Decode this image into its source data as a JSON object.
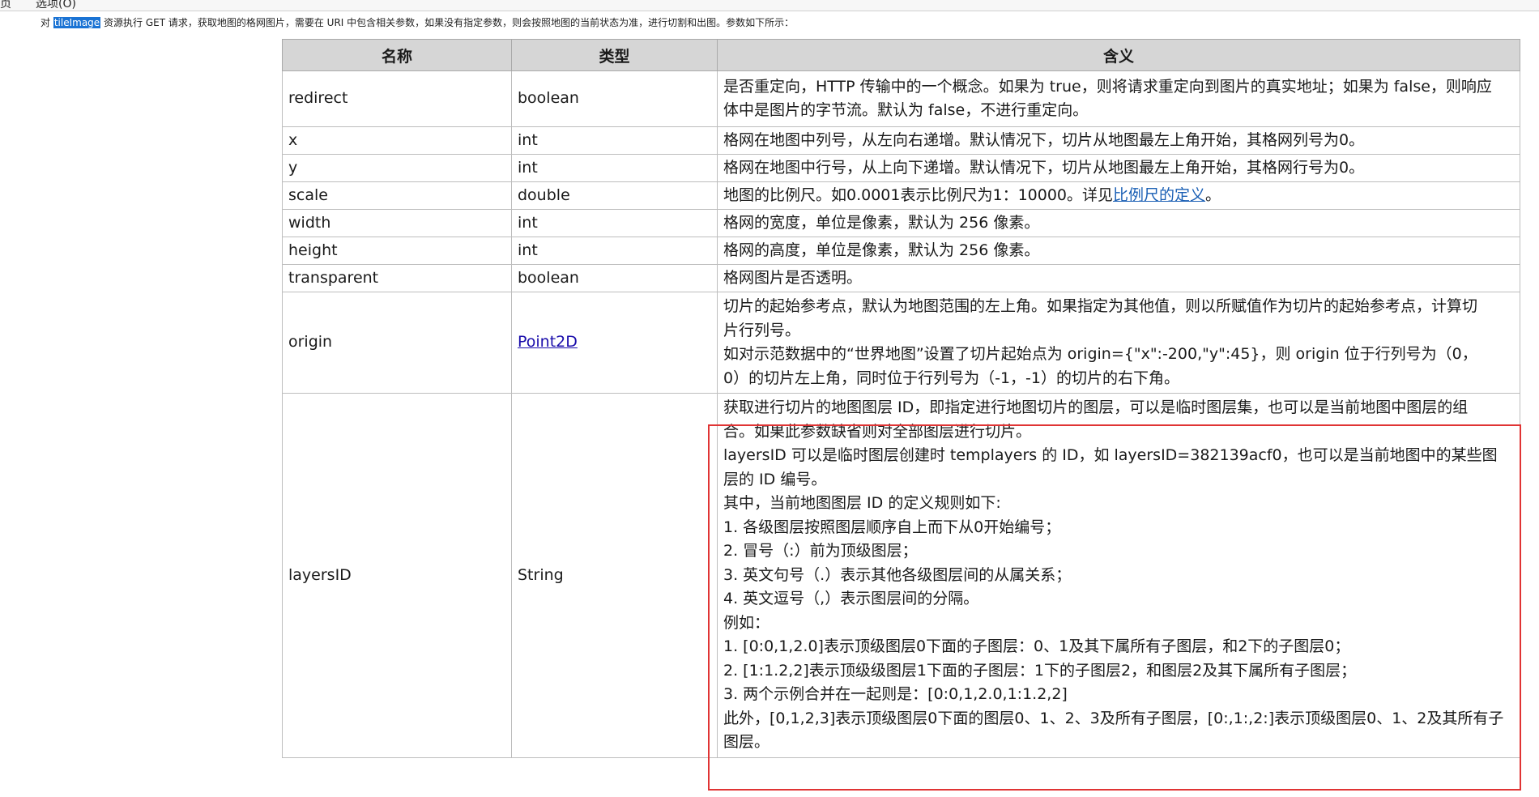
{
  "menubar": {
    "item1": "页",
    "item2": "选项(O)"
  },
  "intro": {
    "prefix": "对",
    "resource": "tileImage",
    "text": "资源执行 GET 请求，获取地图的格网图片，需要在 URI 中包含相关参数，如果没有指定参数，则会按照地图的当前状态为准，进行切割和出图。参数如下所示："
  },
  "table": {
    "headers": [
      "名称",
      "类型",
      "含义"
    ],
    "rows": [
      {
        "name": "redirect",
        "type": "boolean",
        "desc": [
          "是否重定向，HTTP 传输中的一个概念。如果为 true，则将请求重定向到图片的真实地址；如果为 false，则响应",
          "体中是图片的字节流。默认为 false，不进行重定向。"
        ]
      },
      {
        "name": "x",
        "type": "int",
        "desc": [
          "格网在地图中列号，从左向右递增。默认情况下，切片从地图最左上角开始，其格网列号为0。"
        ]
      },
      {
        "name": "y",
        "type": "int",
        "desc": [
          "格网在地图中行号，从上向下递增。默认情况下，切片从地图最左上角开始，其格网行号为0。"
        ]
      },
      {
        "name": "scale",
        "type": "double",
        "desc_prefix": "地图的比例尺。如0.0001表示比例尺为1：10000。详见",
        "desc_link": "比例尺的定义",
        "desc_suffix": "。"
      },
      {
        "name": "width",
        "type": "int",
        "desc": [
          "格网的宽度，单位是像素，默认为 256 像素。"
        ]
      },
      {
        "name": "height",
        "type": "int",
        "desc": [
          "格网的高度，单位是像素，默认为 256 像素。"
        ]
      },
      {
        "name": "transparent",
        "type": "boolean",
        "desc": [
          "格网图片是否透明。"
        ]
      },
      {
        "name": "origin",
        "type": "Point2D",
        "desc": [
          "切片的起始参考点，默认为地图范围的左上角。如果指定为其他值，则以所赋值作为切片的起始参考点，计算切",
          "片行列号。",
          "如对示范数据中的“世界地图”设置了切片起始点为 origin={\"x\":-200,\"y\":45}，则 origin 位于行列号为（0，",
          "0）的切片左上角，同时位于行列号为（-1，-1）的切片的右下角。"
        ]
      },
      {
        "name": "layersID",
        "type": "String",
        "desc": [
          "获取进行切片的地图图层 ID，即指定进行地图切片的图层，可以是临时图层集，也可以是当前地图中图层的组",
          "合。如果此参数缺省则对全部图层进行切片。",
          "layersID 可以是临时图层创建时 templayers 的 ID，如 layersID=382139acf0，也可以是当前地图中的某些图",
          "层的 ID 编号。",
          "其中，当前地图图层 ID 的定义规则如下:",
          "1. 各级图层按照图层顺序自上而下从0开始编号；",
          "2. 冒号（:）前为顶级图层；",
          "3. 英文句号（.）表示其他各级图层间的从属关系；",
          "4. 英文逗号（,）表示图层间的分隔。",
          "例如：",
          "1. [0:0,1,2.0]表示顶级图层0下面的子图层：0、1及其下属所有子图层，和2下的子图层0；",
          "2. [1:1.2,2]表示顶级级图层1下面的子图层：1下的子图层2，和图层2及其下属所有子图层；",
          "3. 两个示例合并在一起则是：[0:0,1,2.0,1:1.2,2]",
          "此外，[0,1,2,3]表示顶级图层0下面的图层0、1、2、3及所有子图层，[0:,1:,2:]表示顶级图层0、1、2及其所有子",
          "图层。"
        ]
      }
    ]
  },
  "colors": {
    "header_bg": "#d6d6d6",
    "highlight_bg": "#1a73d4",
    "link": "#1a5fb4",
    "redbox": "#e03434"
  }
}
